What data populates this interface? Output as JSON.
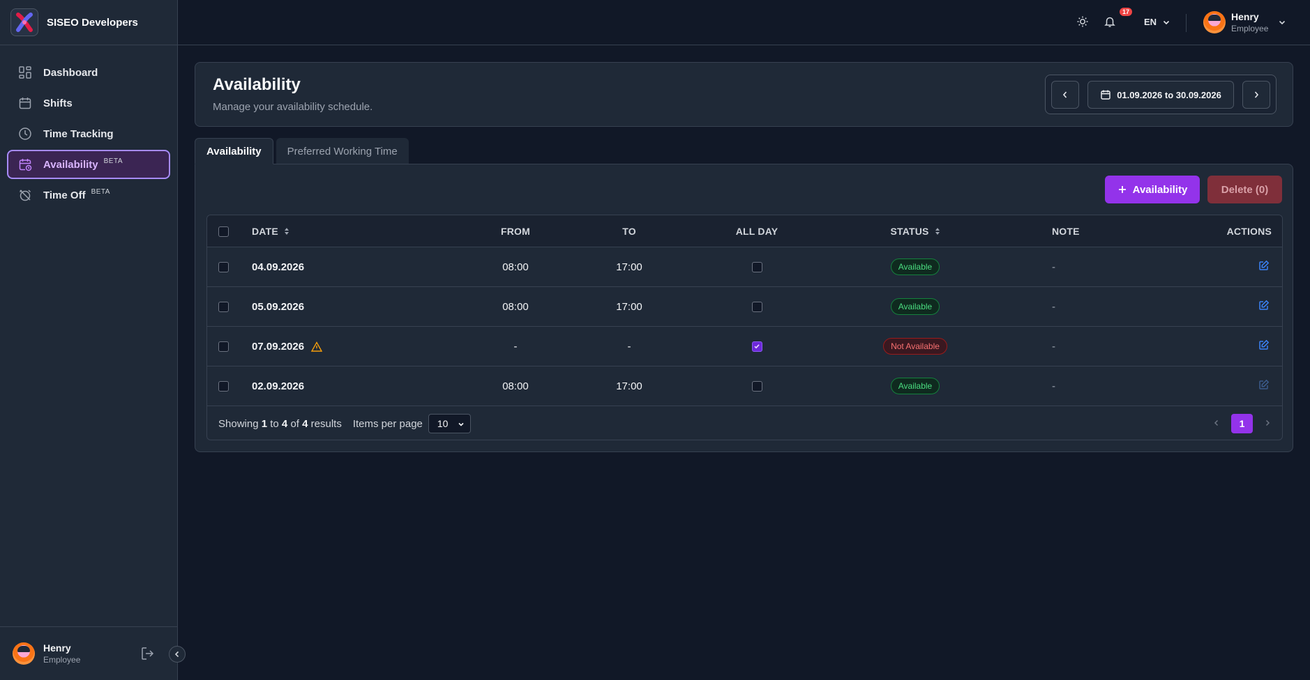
{
  "brand": {
    "name": "SISEO Developers",
    "logo_icon": "siseo-logo-icon"
  },
  "sidebar": {
    "items": [
      {
        "label": "Dashboard",
        "icon": "dashboard-icon",
        "beta": ""
      },
      {
        "label": "Shifts",
        "icon": "calendar-icon",
        "beta": ""
      },
      {
        "label": "Time Tracking",
        "icon": "clock-icon",
        "beta": ""
      },
      {
        "label": "Availability",
        "icon": "calendar-clock-icon",
        "beta": "BETA",
        "active": true
      },
      {
        "label": "Time Off",
        "icon": "alarm-off-icon",
        "beta": "BETA"
      }
    ],
    "user": {
      "name": "Henry",
      "role": "Employee"
    }
  },
  "topbar": {
    "notifications_count": "17",
    "language": "EN",
    "user": {
      "name": "Henry",
      "role": "Employee"
    }
  },
  "header": {
    "title": "Availability",
    "subtitle": "Manage your availability schedule.",
    "date_range": "01.09.2026 to 30.09.2026"
  },
  "tabs": [
    {
      "label": "Availability",
      "active": true
    },
    {
      "label": "Preferred Working Time",
      "active": false
    }
  ],
  "actions": {
    "add_label": "Availability",
    "delete_label": "Delete (0)"
  },
  "table": {
    "columns": {
      "date": "DATE",
      "from": "FROM",
      "to": "TO",
      "all_day": "ALL DAY",
      "status": "STATUS",
      "note": "NOTE",
      "actions": "ACTIONS"
    },
    "rows": [
      {
        "date": "04.09.2026",
        "warning": false,
        "from": "08:00",
        "to": "17:00",
        "all_day": false,
        "status": "Available",
        "note": "-"
      },
      {
        "date": "05.09.2026",
        "warning": false,
        "from": "08:00",
        "to": "17:00",
        "all_day": false,
        "status": "Available",
        "note": "-"
      },
      {
        "date": "07.09.2026",
        "warning": true,
        "from": "-",
        "to": "-",
        "all_day": true,
        "status": "Not Available",
        "note": "-"
      },
      {
        "date": "02.09.2026",
        "warning": false,
        "from": "08:00",
        "to": "17:00",
        "all_day": false,
        "status": "Available",
        "note": "-"
      }
    ]
  },
  "pagination": {
    "showing_prefix": "Showing",
    "from": "1",
    "to_word": "to",
    "to": "4",
    "of_word": "of",
    "total": "4",
    "results_word": "results",
    "items_per_page_label": "Items per page",
    "items_per_page": "10",
    "current_page": "1"
  },
  "colors": {
    "accent": "#9333ea",
    "available": "#4ade80",
    "not_available": "#f87171",
    "background": "#111827"
  }
}
